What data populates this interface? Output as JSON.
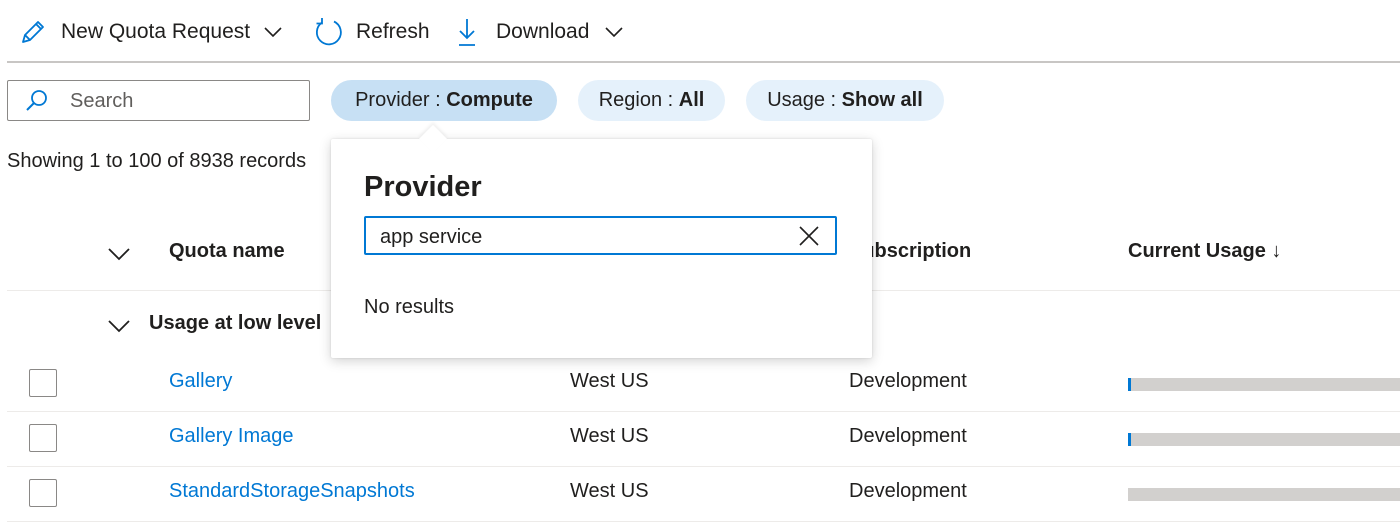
{
  "toolbar": {
    "new_quota": "New Quota Request",
    "refresh": "Refresh",
    "download": "Download"
  },
  "search": {
    "placeholder": "Search",
    "value": ""
  },
  "filters": {
    "provider": {
      "label": "Provider : ",
      "value": "Compute"
    },
    "region": {
      "label": "Region : ",
      "value": "All"
    },
    "usage": {
      "label": "Usage : ",
      "value": "Show all"
    }
  },
  "records_text": "Showing 1 to 100 of 8938 records",
  "columns": {
    "quota_name": "Quota name",
    "subscription": "Subscription",
    "current_usage": "Current Usage ↓"
  },
  "group": {
    "label": "Usage at low level"
  },
  "rows": [
    {
      "name": "Gallery",
      "region": "West US",
      "subscription": "Development",
      "usage": 0.01
    },
    {
      "name": "Gallery Image",
      "region": "West US",
      "subscription": "Development",
      "usage": 0.01
    },
    {
      "name": "StandardStorageSnapshots",
      "region": "West US",
      "subscription": "Development",
      "usage": 0
    }
  ],
  "popup": {
    "title": "Provider",
    "input_value": "app service",
    "no_results": "No results"
  },
  "colors": {
    "accent": "#0078d4",
    "pill": "#e5f1fb",
    "pill_active": "#c7e0f4",
    "bar_track": "#d2d0ce"
  },
  "icons": {
    "new_quota": "pencil-icon",
    "refresh": "refresh-icon",
    "download": "download-icon",
    "search": "search-icon",
    "clear": "close-icon",
    "expand": "chevron-down-icon"
  }
}
